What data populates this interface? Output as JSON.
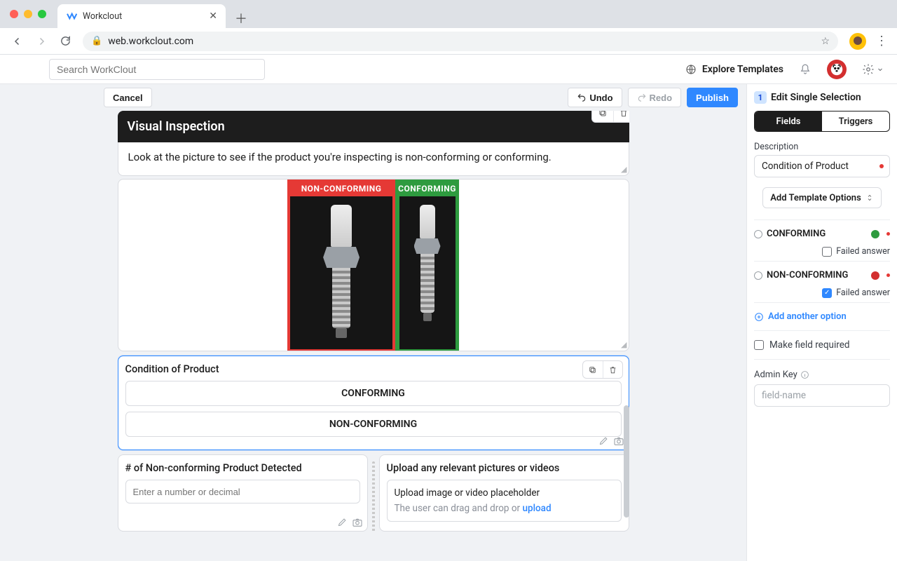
{
  "browser": {
    "tab_title": "Workclout",
    "url_host": "web.workclout.com",
    "url_path": ""
  },
  "app_header": {
    "search_placeholder": "Search WorkClout",
    "explore": "Explore Templates"
  },
  "toolbar": {
    "cancel": "Cancel",
    "undo": "Undo",
    "redo": "Redo",
    "publish": "Publish"
  },
  "section": {
    "title": "Visual Inspection",
    "body": "Look at the picture to see if the product you're inspecting is non-conforming or conforming.",
    "img_labels": {
      "nonconforming": "NON-CONFORMING",
      "conforming": "CONFORMING"
    }
  },
  "condition_card": {
    "title": "Condition of Product",
    "options": [
      "CONFORMING",
      "NON-CONFORMING"
    ]
  },
  "count_card": {
    "title": "# of Non-conforming Product Detected",
    "placeholder": "Enter a number or decimal"
  },
  "upload_card": {
    "title": "Upload any relevant pictures or videos",
    "box_title": "Upload image or video placeholder",
    "box_sub_prefix": "The user can drag and drop or ",
    "box_sub_link": "upload"
  },
  "right_panel": {
    "step_number": "1",
    "title": "Edit Single Selection",
    "tabs": {
      "fields": "Fields",
      "triggers": "Triggers"
    },
    "description_label": "Description",
    "description_value": "Condition of Product",
    "template_btn": "Add Template Options",
    "failed_answer": "Failed answer",
    "options": [
      {
        "label": "CONFORMING",
        "color": "#2e9b3f",
        "failed": false
      },
      {
        "label": "NON-CONFORMING",
        "color": "#d32f2f",
        "failed": true
      }
    ],
    "add_option": "Add another option",
    "make_required": "Make field required",
    "admin_key": "Admin Key",
    "admin_placeholder": "field-name"
  }
}
